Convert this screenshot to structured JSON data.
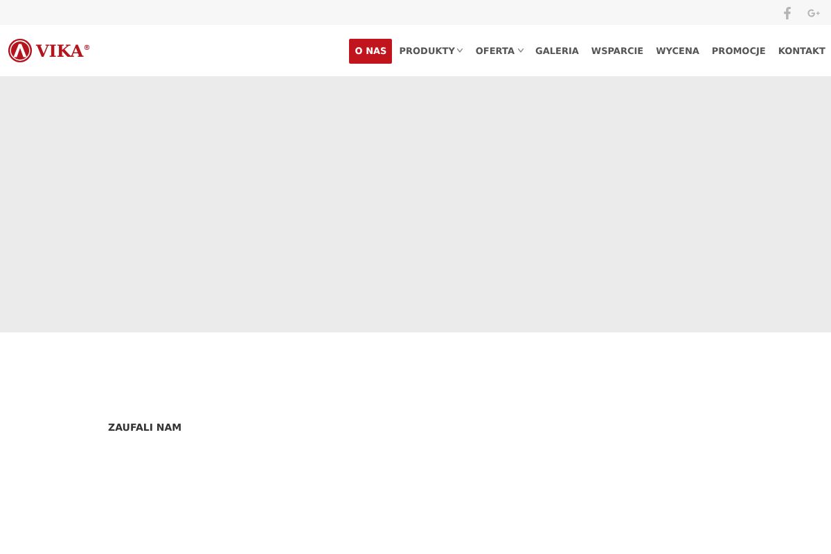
{
  "header": {
    "logo_text": "VIKA$^{®}$",
    "nav": [
      {
        "label": "O NAS",
        "selected": true,
        "dropdown": false
      },
      {
        "label": "PRODUKTY",
        "selected": false,
        "dropdown": true
      },
      {
        "label": "OFERTA",
        "selected": false,
        "dropdown": true
      },
      {
        "label": "GALERIA",
        "selected": false,
        "dropdown": false
      },
      {
        "label": "WSPARCIE",
        "selected": false,
        "dropdown": false
      },
      {
        "label": "WYCENA",
        "selected": false,
        "dropdown": false
      },
      {
        "label": "PROMOCJE",
        "selected": false,
        "dropdown": false
      },
      {
        "label": "KONTAKT",
        "selected": false,
        "dropdown": false
      }
    ]
  },
  "section": {
    "title": "ZAUFALI NAM"
  }
}
